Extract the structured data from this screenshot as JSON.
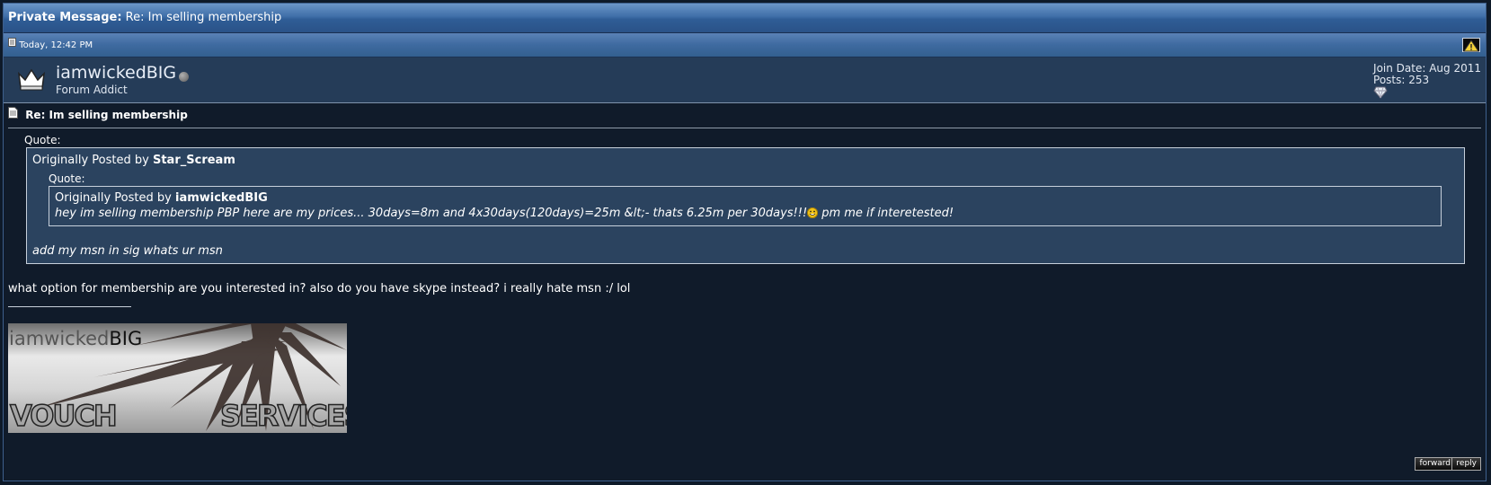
{
  "window": {
    "title_prefix": "Private Message:",
    "title": "Re: Im selling membership"
  },
  "post": {
    "date": "Today, 12:42 PM",
    "username": "iamwickedBIG",
    "user_title": "Forum Addict",
    "join_date": "Join Date: Aug 2011",
    "posts": "Posts: 253",
    "message_title": "Re: Im selling membership",
    "quote": {
      "label": "Quote:",
      "posted_by_prefix": "Originally Posted by",
      "author": "Star_Scream",
      "inner": {
        "label": "Quote:",
        "posted_by_prefix": "Originally Posted by",
        "author": "iamwickedBIG",
        "text": "hey im selling membership PBP here are my prices... 30days=8m and 4x30days(120days)=25m &lt;- thats 6.25m per 30days!!!",
        "text_after": "pm me if interetested!"
      },
      "text": "add my msn in sig whats ur msn"
    },
    "body": "what option for membership are you interested in? also do you have skype instead? i really hate msn :/ lol",
    "signature": {
      "name_a": "iamwicked",
      "name_b": "BIG",
      "left_word": "VOUCH",
      "right_word": "SERVICES"
    }
  },
  "actions": {
    "forward": "forward",
    "reply": "reply"
  },
  "icons": [
    "document-icon",
    "warning-icon",
    "crown-avatar-icon",
    "online-status-icon",
    "gem-icon",
    "smiley-icon"
  ]
}
